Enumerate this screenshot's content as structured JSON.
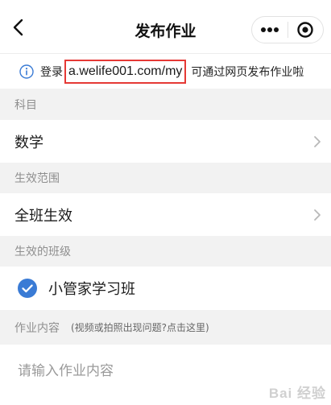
{
  "navbar": {
    "title": "发布作业",
    "back_icon": "chevron-left-icon",
    "more_icon": "more-dots-icon",
    "close_icon": "target-close-icon"
  },
  "notice": {
    "icon": "info-icon",
    "prefix": "登录",
    "url": "a.welife001.com/my",
    "suffix": "可通过网页发布作业啦"
  },
  "subject": {
    "label": "科目",
    "value": "数学"
  },
  "scope": {
    "label": "生效范围",
    "value": "全班生效"
  },
  "classes": {
    "label": "生效的班级",
    "items": [
      {
        "name": "小管家学习班",
        "checked": true
      }
    ]
  },
  "content": {
    "label": "作业内容",
    "hint": "(视频或拍照出现问题?点击这里)",
    "placeholder": "请输入作业内容"
  },
  "watermark": "Bai 经验",
  "colors": {
    "accent": "#3a7bd5",
    "highlight_border": "#e53935",
    "section_bg": "#f2f2f2",
    "label_gray": "#8f8f8f"
  }
}
